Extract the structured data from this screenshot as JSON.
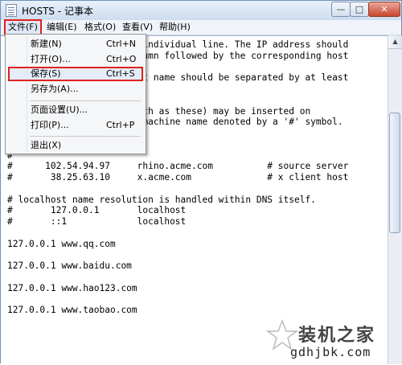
{
  "window": {
    "title": "HOSTS - 记事本",
    "minimize_glyph": "—",
    "maximize_glyph": "□",
    "close_glyph": "✕"
  },
  "menubar": {
    "file": "文件(F)",
    "edit": "编辑(E)",
    "format": "格式(O)",
    "view": "查看(V)",
    "help": "帮助(H)"
  },
  "file_menu": {
    "new": {
      "label": "新建(N)",
      "shortcut": "Ctrl+N"
    },
    "open": {
      "label": "打开(O)...",
      "shortcut": "Ctrl+O"
    },
    "save": {
      "label": "保存(S)",
      "shortcut": "Ctrl+S"
    },
    "save_as": {
      "label": "另存为(A)...",
      "shortcut": ""
    },
    "page_setup": {
      "label": "页面设置(U)...",
      "shortcut": ""
    },
    "print": {
      "label": "打印(P)...",
      "shortcut": "Ctrl+P"
    },
    "exit": {
      "label": "退出(X)",
      "shortcut": ""
    }
  },
  "document": {
    "text": "                      an individual line. The IP address should\n                      column followed by the corresponding host\n\n                      host name should be separated by at least\n\n\n                      (such as these) may be inserted on\n# lines or following the machine name denoted by a '#' symbol.\n#\n# For example:\n#\n#      102.54.94.97     rhino.acme.com          # source server\n#       38.25.63.10     x.acme.com              # x client host\n\n# localhost name resolution is handled within DNS itself.\n#\t127.0.0.1       localhost\n#\t::1             localhost\n\n127.0.0.1 www.qq.com\n\n127.0.0.1 www.baidu.com\n\n127.0.0.1 www.hao123.com\n\n127.0.0.1 www.taobao.com"
  },
  "watermark": {
    "title": "装机之家",
    "url": "gdhjbk.com"
  },
  "colors": {
    "highlight_border": "#e0201c",
    "title_bar": "#dbe6f3"
  }
}
